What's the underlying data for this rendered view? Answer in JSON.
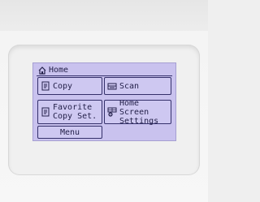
{
  "screen": {
    "title": "Home",
    "buttons": {
      "copy": "Copy",
      "scan": "Scan",
      "favorite": "Favorite\nCopy Set.",
      "home_settings": "Home Screen\nSettings",
      "menu": "Menu"
    }
  },
  "icons": {
    "title": "home-icon",
    "copy": "copy-document-icon",
    "scan": "scanner-icon",
    "favorite": "favorite-document-icon",
    "home_settings": "home-settings-gear-icon"
  },
  "colors": {
    "lcd_background": "#c9c2ee",
    "lcd_foreground": "#24214a",
    "bezel": "#f4f4f4"
  }
}
